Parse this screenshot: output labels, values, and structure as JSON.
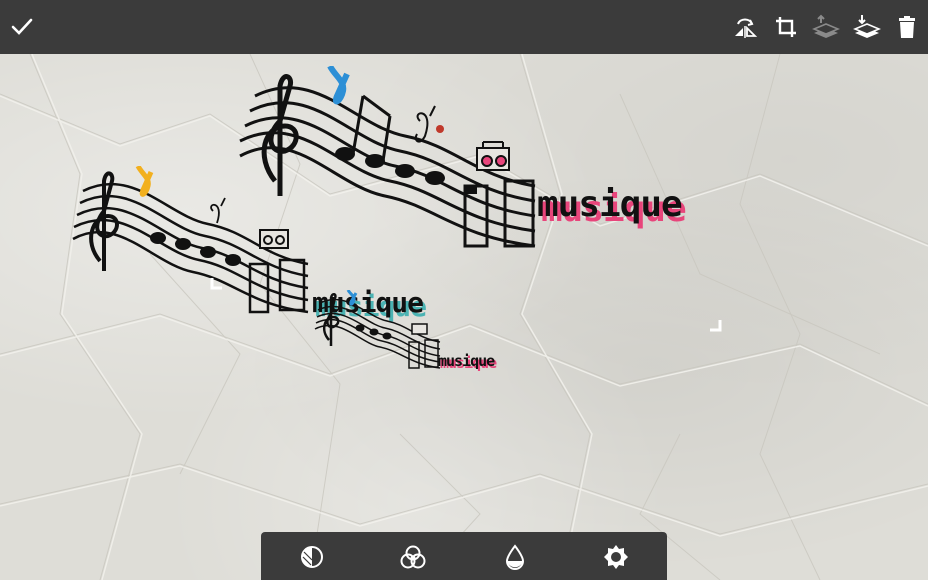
{
  "toolbar": {
    "icons": [
      "check-icon",
      "flip-icon",
      "crop-icon",
      "layer-up-icon",
      "layer-down-icon",
      "trash-icon"
    ],
    "layer_up_disabled": true
  },
  "stickers": [
    {
      "word": "musique",
      "word_color": "#e8457b"
    },
    {
      "word": "musique",
      "word_color": "#4bb3b3"
    },
    {
      "word": "musique",
      "word_color": "#e8457b"
    }
  ],
  "bottom_toolbar": {
    "icons": [
      "blend-icon",
      "color-mix-icon",
      "opacity-icon",
      "settings-icon"
    ]
  },
  "colors": {
    "bar": "#3b3b3b",
    "icon": "#ffffff",
    "icon_disabled": "#8a8a8a",
    "paper": "#deddd7",
    "sax_blue": "#2c8fd6",
    "sax_gold": "#f2b01e"
  }
}
